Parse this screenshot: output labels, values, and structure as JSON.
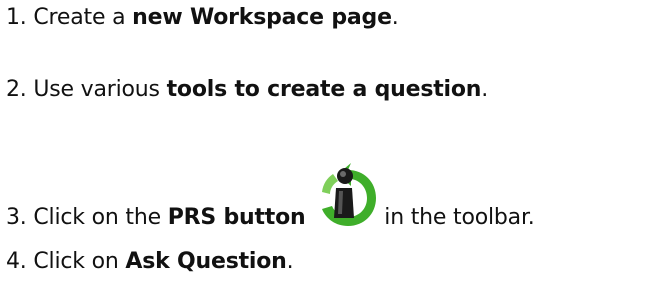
{
  "steps": [
    {
      "number": "1.",
      "pre": "Create a ",
      "bold": "new Workspace page",
      "post": "."
    },
    {
      "number": "2.",
      "pre": "Use various ",
      "bold": "tools to create a question",
      "post": "."
    },
    {
      "number": "3.",
      "pre": "Click on the ",
      "bold": "PRS button",
      "icon": "prs-info-icon",
      "post": "in the toolbar."
    },
    {
      "number": "4.",
      "pre": "Click on ",
      "bold": "Ask Question",
      "post": "."
    }
  ],
  "colors": {
    "icon_green": "#3fae2a",
    "icon_dark": "#1a1a1a",
    "text": "#111111"
  }
}
